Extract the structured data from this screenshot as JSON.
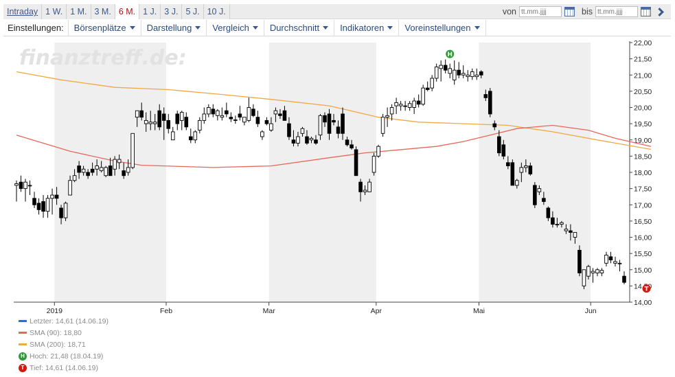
{
  "range_tabs": [
    "Intraday",
    "1 W.",
    "1 M.",
    "3 M.",
    "6 M.",
    "1 J.",
    "3 J.",
    "5 J.",
    "10 J."
  ],
  "active_range": "6 M.",
  "date_range": {
    "from_label": "von",
    "to_label": "bis",
    "from_placeholder": "tt.mm.jjjj",
    "to_placeholder": "tt.mm.jjjj"
  },
  "settings": {
    "label": "Einstellungen:",
    "menus": [
      "Börsenplätze",
      "Darstellung",
      "Vergleich",
      "Durchschnitt",
      "Indikatoren",
      "Voreinstellungen"
    ]
  },
  "watermark": "finanztreff.de:",
  "colors": {
    "candle": "#000000",
    "sma90": "#e8665a",
    "sma200": "#f0a843",
    "last": "#2e6fb5",
    "high_marker": "#2e9a36",
    "low_marker": "#d01a10",
    "band": "#efefef"
  },
  "legend": [
    {
      "text": "Letzter: 14,61 (14.06.19)",
      "type": "line",
      "color": "#2e6fb5"
    },
    {
      "text": "SMA (90): 18,80",
      "type": "line",
      "color": "#e8665a"
    },
    {
      "text": "SMA (200): 18,71",
      "type": "line",
      "color": "#f0a843"
    },
    {
      "text": "Hoch: 21,48 (18.04.19)",
      "type": "marker",
      "symbol": "H",
      "color": "#2e9a36"
    },
    {
      "text": "Tief: 14,61 (14.06.19)",
      "type": "marker",
      "symbol": "T",
      "color": "#d01a10"
    }
  ],
  "chart_data": {
    "type": "candlestick",
    "ylim": [
      14.0,
      22.0
    ],
    "y_ticks": [
      "22,00",
      "21,50",
      "21,00",
      "20,50",
      "20,00",
      "19,50",
      "19,00",
      "18,50",
      "18,00",
      "17,50",
      "17,00",
      "16,50",
      "16,00",
      "15,50",
      "15,00",
      "14,50",
      "14,00"
    ],
    "x_tick_labels": [
      "2019",
      "Feb",
      "Mar",
      "Apr",
      "Mai",
      "Jun"
    ],
    "month_band_labels": [
      "2019",
      "Feb",
      "Mar",
      "Apr",
      "Mai",
      "Jun"
    ],
    "month_boundaries_index": [
      9,
      34,
      57,
      81,
      104,
      129
    ],
    "shaded_months": [
      "2019",
      "Mar",
      "Mai"
    ],
    "candles": [
      [
        17.6,
        17.75,
        17.1,
        17.65
      ],
      [
        17.7,
        17.9,
        17.4,
        17.5
      ],
      [
        17.5,
        17.8,
        17.1,
        17.7
      ],
      [
        17.6,
        17.75,
        17.3,
        17.6
      ],
      [
        17.2,
        17.4,
        16.9,
        17.0
      ],
      [
        17.05,
        17.2,
        16.7,
        16.85
      ],
      [
        17.1,
        17.3,
        16.6,
        16.8
      ],
      [
        16.8,
        17.3,
        16.6,
        17.2
      ],
      [
        17.2,
        17.5,
        16.7,
        17.3
      ],
      [
        17.3,
        17.55,
        17.0,
        17.2
      ],
      [
        16.9,
        17.0,
        16.4,
        16.6
      ],
      [
        16.6,
        17.1,
        16.5,
        17.05
      ],
      [
        17.3,
        17.9,
        17.3,
        17.75
      ],
      [
        17.75,
        18.1,
        17.7,
        17.9
      ],
      [
        18.2,
        18.35,
        17.8,
        18.0
      ],
      [
        18.0,
        18.2,
        17.9,
        18.1
      ],
      [
        18.0,
        18.1,
        17.8,
        17.9
      ],
      [
        18.1,
        18.3,
        17.9,
        18.0
      ],
      [
        18.1,
        18.4,
        17.9,
        18.2
      ],
      [
        18.05,
        18.35,
        18.0,
        18.15
      ],
      [
        17.9,
        18.2,
        17.85,
        18.15
      ],
      [
        18.2,
        18.45,
        17.9,
        17.9
      ],
      [
        18.1,
        18.5,
        17.9,
        18.4
      ],
      [
        18.3,
        18.55,
        18.1,
        18.4
      ],
      [
        18.05,
        18.3,
        17.8,
        17.9
      ],
      [
        18.0,
        18.4,
        17.9,
        18.15
      ],
      [
        18.15,
        19.2,
        18.1,
        19.2
      ],
      [
        19.7,
        19.9,
        19.4,
        19.9
      ],
      [
        19.9,
        20.15,
        19.6,
        19.7
      ],
      [
        19.5,
        19.85,
        19.25,
        19.6
      ],
      [
        19.5,
        19.9,
        19.3,
        19.55
      ],
      [
        19.5,
        19.8,
        19.3,
        19.55
      ],
      [
        19.9,
        20.1,
        19.3,
        19.4
      ],
      [
        19.8,
        20.0,
        19.0,
        19.6
      ],
      [
        19.6,
        19.8,
        19.2,
        19.35
      ],
      [
        19.0,
        19.4,
        19.0,
        19.25
      ],
      [
        19.8,
        19.9,
        19.3,
        19.5
      ],
      [
        19.6,
        19.9,
        19.3,
        19.85
      ],
      [
        19.7,
        19.85,
        19.3,
        19.4
      ],
      [
        19.1,
        19.35,
        18.9,
        19.0
      ],
      [
        19.0,
        19.3,
        18.9,
        19.25
      ],
      [
        19.3,
        19.7,
        19.2,
        19.6
      ],
      [
        19.6,
        20.0,
        19.5,
        19.8
      ],
      [
        19.8,
        20.1,
        19.7,
        20.0
      ],
      [
        19.95,
        20.1,
        19.7,
        19.8
      ],
      [
        19.75,
        19.95,
        19.6,
        19.9
      ],
      [
        19.7,
        20.0,
        19.6,
        19.75
      ],
      [
        19.9,
        20.15,
        19.7,
        19.8
      ],
      [
        19.7,
        19.85,
        19.55,
        19.65
      ],
      [
        19.6,
        19.75,
        19.5,
        19.62
      ],
      [
        19.8,
        20.05,
        19.6,
        19.7
      ],
      [
        19.55,
        19.7,
        19.45,
        19.7
      ],
      [
        19.6,
        20.3,
        19.55,
        20.0
      ],
      [
        19.95,
        20.1,
        19.7,
        19.75
      ],
      [
        19.7,
        19.9,
        19.4,
        19.5
      ],
      [
        19.1,
        19.3,
        19.0,
        19.25
      ],
      [
        19.6,
        19.7,
        19.45,
        19.5
      ],
      [
        19.3,
        19.7,
        19.25,
        19.5
      ],
      [
        19.8,
        20.0,
        19.55,
        19.9
      ],
      [
        19.8,
        19.95,
        19.65,
        19.75
      ],
      [
        19.9,
        20.05,
        19.6,
        19.6
      ],
      [
        19.5,
        19.7,
        19.0,
        19.1
      ],
      [
        19.0,
        19.3,
        18.8,
        18.9
      ],
      [
        18.9,
        19.25,
        18.8,
        19.1
      ],
      [
        19.2,
        19.4,
        19.1,
        19.35
      ],
      [
        19.1,
        19.3,
        18.85,
        18.9
      ],
      [
        19.0,
        19.1,
        18.9,
        19.05
      ],
      [
        19.0,
        19.15,
        18.85,
        18.9
      ],
      [
        19.15,
        19.8,
        19.0,
        19.75
      ],
      [
        19.75,
        19.85,
        19.4,
        19.55
      ],
      [
        19.8,
        19.95,
        19.0,
        19.2
      ],
      [
        19.6,
        19.8,
        19.45,
        19.55
      ],
      [
        19.4,
        19.6,
        19.05,
        19.2
      ],
      [
        19.8,
        20.0,
        19.0,
        19.2
      ],
      [
        19.0,
        19.1,
        18.8,
        18.85
      ],
      [
        18.85,
        19.0,
        18.7,
        18.75
      ],
      [
        18.7,
        18.8,
        17.9,
        17.9
      ],
      [
        17.7,
        17.8,
        17.1,
        17.4
      ],
      [
        17.4,
        17.6,
        17.3,
        17.45
      ],
      [
        17.4,
        17.8,
        17.4,
        17.7
      ],
      [
        18.0,
        18.6,
        17.9,
        18.5
      ],
      [
        18.5,
        18.85,
        18.45,
        18.8
      ],
      [
        19.2,
        19.8,
        19.1,
        19.7
      ],
      [
        19.7,
        20.0,
        19.4,
        19.75
      ],
      [
        19.8,
        20.1,
        19.6,
        20.0
      ],
      [
        20.05,
        20.3,
        19.8,
        20.15
      ],
      [
        20.05,
        20.2,
        19.9,
        20.1
      ],
      [
        20.05,
        20.2,
        19.9,
        20.05
      ],
      [
        20.0,
        20.2,
        19.9,
        20.12
      ],
      [
        20.0,
        20.3,
        19.8,
        20.2
      ],
      [
        20.2,
        20.4,
        20.0,
        20.1
      ],
      [
        20.1,
        20.7,
        20.05,
        20.6
      ],
      [
        20.6,
        20.8,
        20.5,
        20.55
      ],
      [
        20.6,
        21.0,
        20.5,
        20.9
      ],
      [
        20.9,
        21.35,
        20.8,
        21.25
      ],
      [
        21.2,
        21.45,
        20.8,
        21.3
      ],
      [
        21.3,
        21.48,
        21.05,
        21.15
      ],
      [
        21.05,
        21.35,
        20.9,
        21.2
      ],
      [
        20.85,
        21.45,
        20.7,
        21.15
      ],
      [
        21.15,
        21.4,
        20.9,
        21.0
      ],
      [
        21.0,
        21.3,
        20.9,
        21.05
      ],
      [
        20.95,
        21.15,
        20.8,
        21.0
      ],
      [
        20.95,
        21.2,
        20.85,
        21.1
      ],
      [
        20.95,
        21.2,
        20.85,
        21.0
      ],
      [
        21.1,
        21.15,
        20.9,
        21.0
      ],
      [
        20.4,
        20.55,
        20.2,
        20.3
      ],
      [
        20.5,
        20.6,
        19.7,
        19.8
      ],
      [
        19.5,
        19.6,
        19.3,
        19.4
      ],
      [
        19.1,
        19.3,
        18.5,
        18.6
      ],
      [
        18.85,
        19.0,
        18.4,
        18.5
      ],
      [
        18.3,
        18.5,
        18.1,
        18.2
      ],
      [
        18.3,
        18.4,
        17.6,
        17.6
      ],
      [
        17.6,
        17.8,
        17.5,
        17.75
      ],
      [
        18.0,
        18.3,
        17.7,
        18.15
      ],
      [
        18.15,
        18.4,
        18.0,
        18.2
      ],
      [
        18.2,
        18.3,
        17.9,
        17.95
      ],
      [
        17.6,
        17.7,
        16.9,
        17.0
      ],
      [
        17.4,
        17.6,
        17.3,
        17.5
      ],
      [
        17.2,
        17.4,
        17.0,
        17.1
      ],
      [
        16.9,
        16.95,
        16.5,
        16.6
      ],
      [
        16.6,
        16.8,
        16.3,
        16.4
      ],
      [
        16.4,
        16.6,
        16.3,
        16.4
      ],
      [
        16.4,
        16.5,
        16.3,
        16.45
      ],
      [
        16.2,
        16.4,
        16.1,
        16.25
      ],
      [
        16.2,
        16.4,
        15.9,
        16.15
      ],
      [
        16.0,
        16.1,
        15.8,
        16.15
      ],
      [
        15.6,
        15.75,
        14.8,
        14.9
      ],
      [
        14.5,
        15.0,
        14.4,
        15.0
      ],
      [
        14.8,
        15.15,
        14.7,
        15.1
      ],
      [
        14.9,
        15.05,
        14.6,
        14.95
      ],
      [
        14.9,
        15.05,
        14.8,
        15.0
      ],
      [
        14.9,
        15.05,
        14.8,
        14.98
      ],
      [
        15.2,
        15.55,
        15.1,
        15.45
      ],
      [
        15.4,
        15.55,
        15.2,
        15.3
      ],
      [
        15.2,
        15.4,
        15.1,
        15.25
      ],
      [
        15.2,
        15.3,
        14.95,
        15.2
      ],
      [
        14.8,
        14.95,
        14.55,
        14.61
      ]
    ],
    "sma90": [
      [
        0,
        19.15
      ],
      [
        12,
        18.65
      ],
      [
        22,
        18.35
      ],
      [
        28,
        18.22
      ],
      [
        44,
        18.15
      ],
      [
        57,
        18.2
      ],
      [
        70,
        18.45
      ],
      [
        78,
        18.6
      ],
      [
        82,
        18.65
      ],
      [
        94,
        18.8
      ],
      [
        100,
        18.95
      ],
      [
        106,
        19.15
      ],
      [
        112,
        19.35
      ],
      [
        120,
        19.45
      ],
      [
        128,
        19.3
      ],
      [
        134,
        19.05
      ],
      [
        142,
        18.8
      ]
    ],
    "sma200": [
      [
        0,
        21.1
      ],
      [
        10,
        20.85
      ],
      [
        22,
        20.62
      ],
      [
        34,
        20.55
      ],
      [
        46,
        20.4
      ],
      [
        57,
        20.25
      ],
      [
        70,
        20.05
      ],
      [
        81,
        19.7
      ],
      [
        90,
        19.55
      ],
      [
        100,
        19.5
      ],
      [
        110,
        19.45
      ],
      [
        120,
        19.25
      ],
      [
        130,
        19.0
      ],
      [
        142,
        18.71
      ]
    ],
    "high_marker": {
      "index": 97,
      "value": 21.48,
      "symbol": "H"
    },
    "low_marker": {
      "index": 141,
      "value": 14.61,
      "symbol": "T"
    }
  }
}
